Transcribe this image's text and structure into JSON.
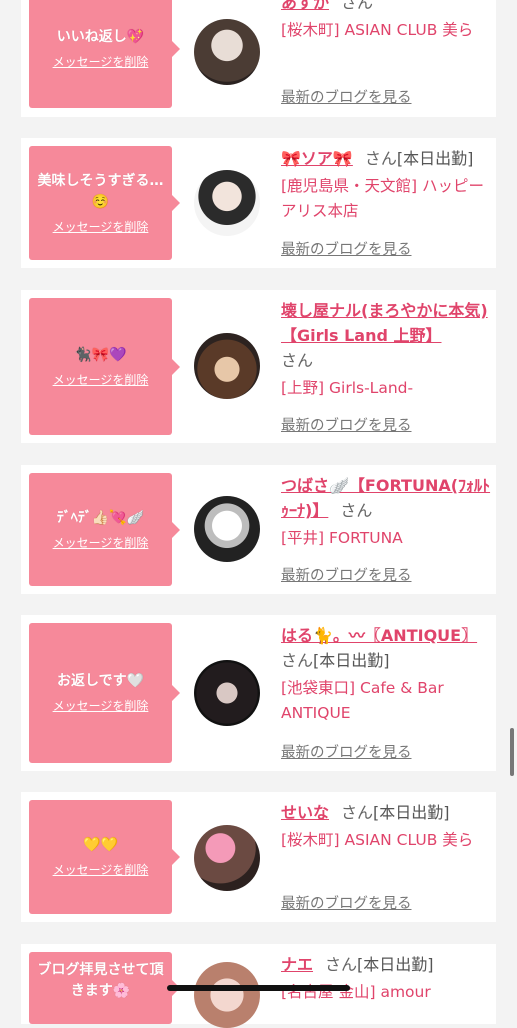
{
  "theme": {
    "accent": "#e0446b",
    "bubble": "#f6899a"
  },
  "cards": [
    {
      "message": "いいね返し💖",
      "delete_label": "メッセージを削除",
      "name": "あすか",
      "san": "さん",
      "status": "",
      "shop": "[桜木町] ASIAN CLUB 美ら",
      "blog_label": "最新のブログを見る",
      "avatar": "avatar-photo"
    },
    {
      "message": "美味しそうすぎる…☺️",
      "delete_label": "メッセージを削除",
      "name": "🎀ソア🎀",
      "san": "さん",
      "status": "[本日出勤]",
      "shop": "[鹿児島県・天文館] ハッピーアリス本店",
      "blog_label": "最新のブログを見る",
      "avatar": "avatar-photo"
    },
    {
      "message": "🐈‍⬛🎀💜",
      "delete_label": "メッセージを削除",
      "name": "壊し屋ナル(まろやかに本気)【Girls Land 上野】",
      "san": "さん",
      "status": "",
      "shop": "[上野] Girls-Land-",
      "blog_label": "最新のブログを見る",
      "avatar": "avatar-photo"
    },
    {
      "message": "ﾃﾞﾍﾃﾞ👍🏻💘🪽",
      "delete_label": "メッセージを削除",
      "name": "つばさ🪽【FORTUNA(ﾌｫﾙﾄｩｰﾅ)】",
      "san": "さん",
      "status": "",
      "shop": "[平井] FORTUNA",
      "blog_label": "最新のブログを見る",
      "avatar": "avatar-photo"
    },
    {
      "message": "お返しです🤍",
      "delete_label": "メッセージを削除",
      "name": "はる🐈。〰〖ANTIQUE〗",
      "san": "さん",
      "status": "[本日出勤]",
      "shop": "[池袋東口] Cafe & Bar ANTIQUE",
      "blog_label": "最新のブログを見る",
      "avatar": "avatar-photo"
    },
    {
      "message": "💛💛",
      "delete_label": "メッセージを削除",
      "name": "せいな",
      "san": "さん",
      "status": "[本日出勤]",
      "shop": "[桜木町] ASIAN CLUB 美ら",
      "blog_label": "最新のブログを見る",
      "avatar": "avatar-photo"
    },
    {
      "message": "ブログ拝見させて頂きます🌸",
      "delete_label": "",
      "name": "ナエ",
      "san": "さん",
      "status": "[本日出勤]",
      "shop": "[名古屋 金山] amour",
      "blog_label": "",
      "avatar": "avatar-photo"
    }
  ]
}
